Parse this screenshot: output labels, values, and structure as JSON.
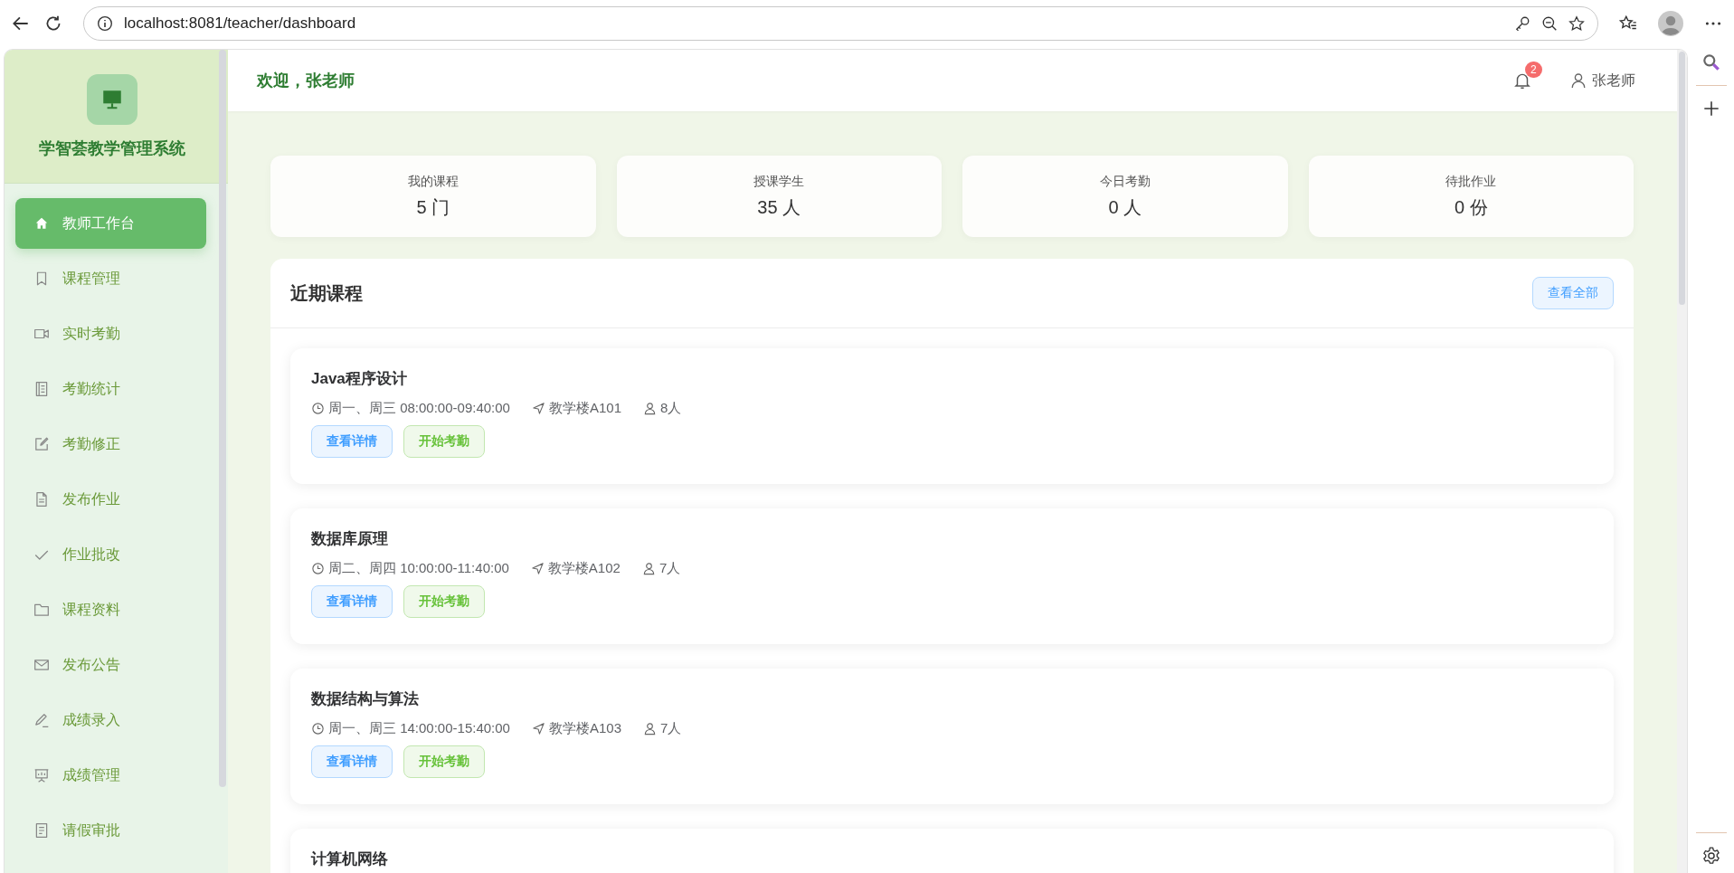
{
  "browser": {
    "url": "localhost:8081/teacher/dashboard"
  },
  "sidebar": {
    "title": "学智荟教学管理系统",
    "items": [
      {
        "label": "教师工作台",
        "selected": true
      },
      {
        "label": "课程管理",
        "selected": false
      },
      {
        "label": "实时考勤",
        "selected": false
      },
      {
        "label": "考勤统计",
        "selected": false
      },
      {
        "label": "考勤修正",
        "selected": false
      },
      {
        "label": "发布作业",
        "selected": false
      },
      {
        "label": "作业批改",
        "selected": false
      },
      {
        "label": "课程资料",
        "selected": false
      },
      {
        "label": "发布公告",
        "selected": false
      },
      {
        "label": "成绩录入",
        "selected": false
      },
      {
        "label": "成绩管理",
        "selected": false
      },
      {
        "label": "请假审批",
        "selected": false
      }
    ]
  },
  "header": {
    "welcome": "欢迎，张老师",
    "notifications": "2",
    "user": "张老师"
  },
  "stats": [
    {
      "label": "我的课程",
      "value": "5 门"
    },
    {
      "label": "授课学生",
      "value": "35 人"
    },
    {
      "label": "今日考勤",
      "value": "0 人"
    },
    {
      "label": "待批作业",
      "value": "0 份"
    }
  ],
  "recent_courses": {
    "title": "近期课程",
    "view_all": "查看全部",
    "courses": [
      {
        "name": "Java程序设计",
        "time": "周一、周三 08:00:00-09:40:00",
        "location": "教学楼A101",
        "students": "8人",
        "actions": [
          {
            "label": "查看详情",
            "kind": "info"
          },
          {
            "label": "开始考勤",
            "kind": "success"
          }
        ]
      },
      {
        "name": "数据库原理",
        "time": "周二、周四 10:00:00-11:40:00",
        "location": "教学楼A102",
        "students": "7人",
        "actions": [
          {
            "label": "查看详情",
            "kind": "info"
          },
          {
            "label": "开始考勤",
            "kind": "success"
          }
        ]
      },
      {
        "name": "数据结构与算法",
        "time": "周一、周三 14:00:00-15:40:00",
        "location": "教学楼A103",
        "students": "7人",
        "actions": [
          {
            "label": "查看详情",
            "kind": "info"
          },
          {
            "label": "开始考勤",
            "kind": "success"
          }
        ]
      },
      {
        "name": "计算机网络"
      }
    ]
  }
}
